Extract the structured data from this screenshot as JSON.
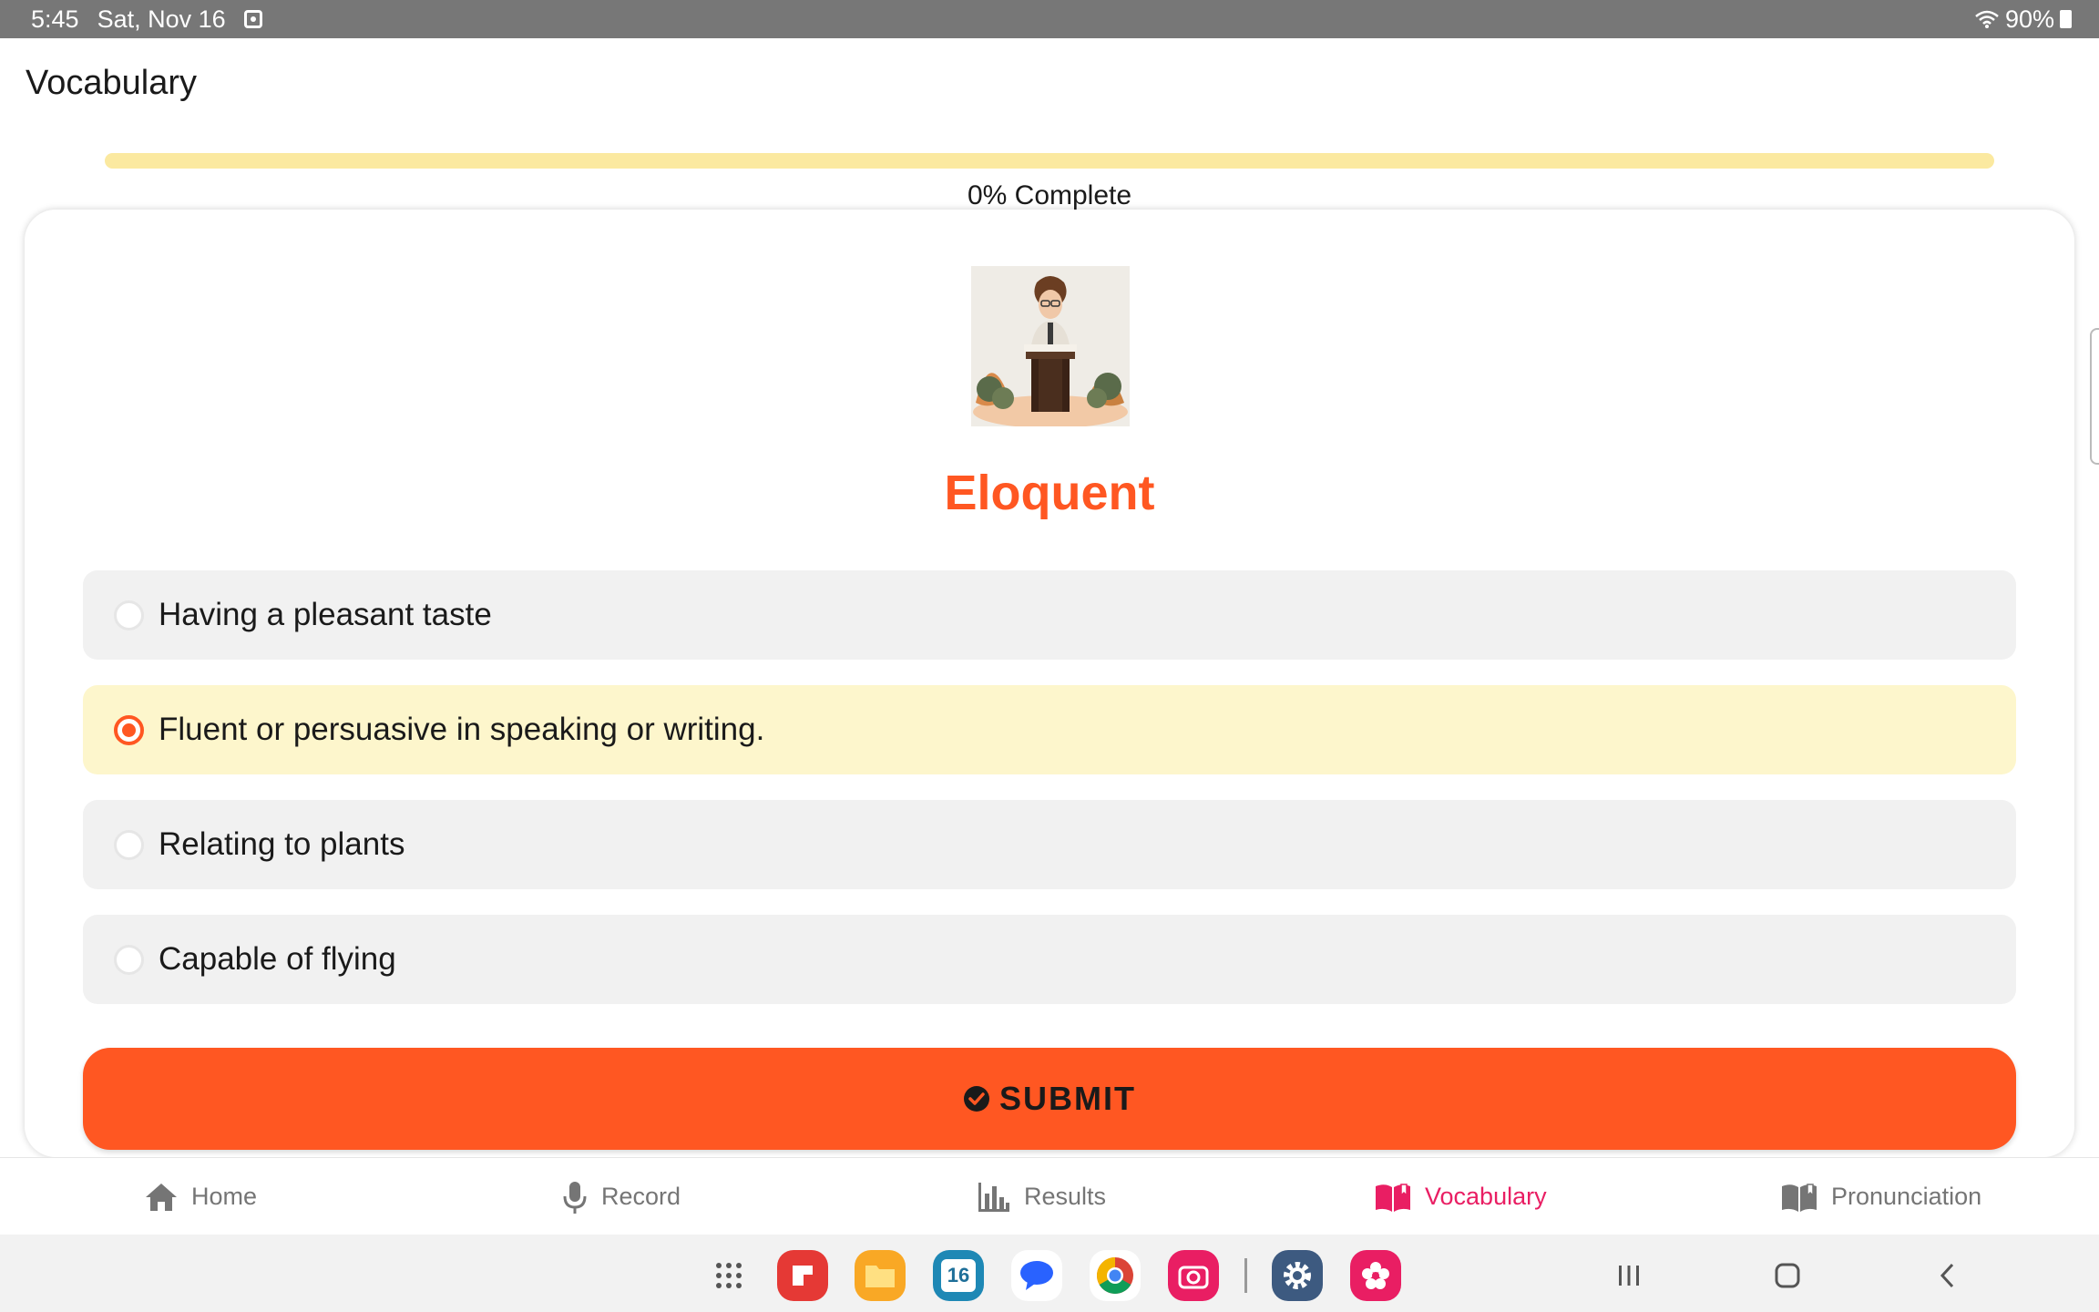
{
  "status_bar": {
    "time": "5:45",
    "date": "Sat, Nov 16",
    "battery": "90%",
    "icons": [
      "notification-icon",
      "wifi-icon",
      "battery-icon"
    ]
  },
  "header": {
    "title": "Vocabulary"
  },
  "progress": {
    "value": 0,
    "label": "0% Complete",
    "track_color": "#fbe9a0",
    "fill_color": "#ff5722"
  },
  "quiz": {
    "word": "Eloquent",
    "image_alt": "illustration of a speaker at a podium",
    "options": [
      {
        "label": "Having a pleasant taste",
        "selected": false
      },
      {
        "label": "Fluent or persuasive in speaking or writing.",
        "selected": true
      },
      {
        "label": "Relating to plants",
        "selected": false
      },
      {
        "label": "Capable of flying",
        "selected": false
      }
    ],
    "submit_label": "SUBMIT",
    "submit_icon": "check-circle-icon"
  },
  "bottom_nav": {
    "items": [
      {
        "label": "Home",
        "icon": "home-icon",
        "active": false
      },
      {
        "label": "Record",
        "icon": "microphone-icon",
        "active": false
      },
      {
        "label": "Results",
        "icon": "bar-chart-icon",
        "active": false
      },
      {
        "label": "Vocabulary",
        "icon": "book-icon",
        "active": true
      },
      {
        "label": "Pronunciation",
        "icon": "book-icon",
        "active": false
      }
    ]
  },
  "system_nav": {
    "calendar_day": "16",
    "dock": [
      "apps-grid-icon",
      "flipboard-icon",
      "files-icon",
      "calendar-icon",
      "messages-icon",
      "chrome-icon",
      "camera-icon",
      "settings-icon",
      "blossom-icon"
    ],
    "buttons": [
      "recents-button",
      "home-button",
      "back-button"
    ]
  },
  "colors": {
    "accent": "#ff5722",
    "nav_active": "#e91e63",
    "nav_inactive": "#757575",
    "selected_option_bg": "#fdf6cc"
  }
}
